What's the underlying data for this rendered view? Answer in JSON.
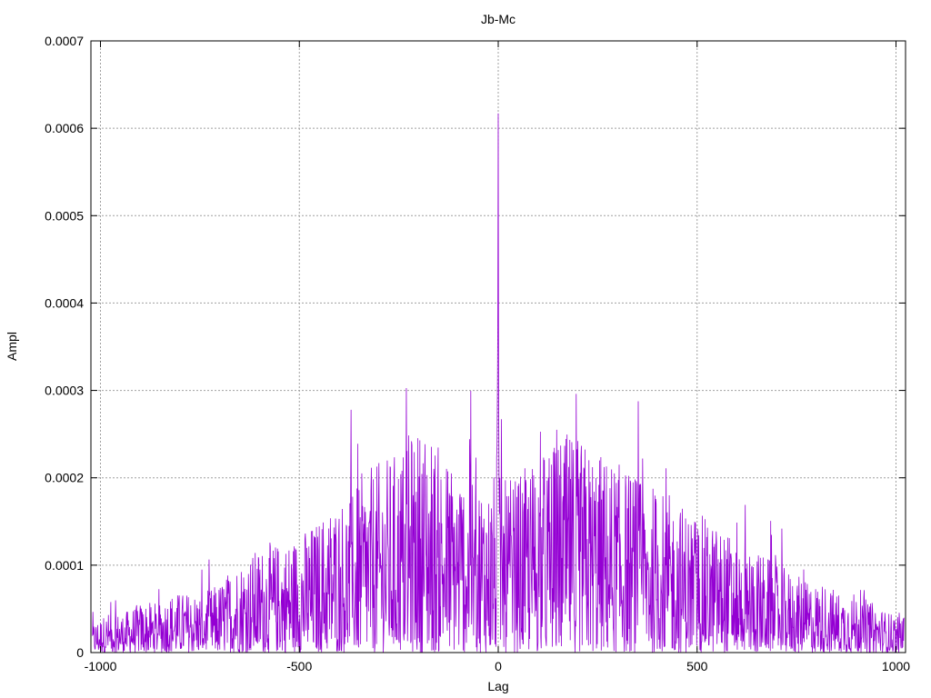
{
  "chart_data": {
    "type": "line",
    "title": "Jb-Mc",
    "xlabel": "Lag",
    "ylabel": "Ampl",
    "xlim": [
      -1024,
      1024
    ],
    "ylim": [
      0,
      0.0007
    ],
    "xticks": [
      -1000,
      -500,
      0,
      500,
      1000
    ],
    "xtick_labels": [
      "-1000",
      "-500",
      "0",
      "500",
      "1000"
    ],
    "yticks": [
      0,
      0.0001,
      0.0002,
      0.0003,
      0.0004,
      0.0005,
      0.0006,
      0.0007
    ],
    "ytick_labels": [
      "0",
      "0.0001",
      "0.0002",
      "0.0003",
      "0.0004",
      "0.0005",
      "0.0006",
      "0.0007"
    ],
    "grid": true,
    "legend": "none",
    "series": [
      {
        "color": "#9400d3",
        "x": [
          -1020,
          -980,
          -940,
          -900,
          -860,
          -820,
          -780,
          -740,
          -700,
          -660,
          -620,
          -580,
          -540,
          -500,
          -460,
          -420,
          -380,
          -340,
          -300,
          -260,
          -220,
          -180,
          -140,
          -100,
          -60,
          -20,
          -10,
          -5,
          -2,
          -1,
          0,
          1,
          2,
          5,
          10,
          20,
          60,
          100,
          140,
          180,
          220,
          260,
          300,
          340,
          380,
          420,
          460,
          500,
          540,
          580,
          620,
          660,
          700,
          740,
          780,
          820,
          860,
          900,
          940,
          980,
          1020
        ],
        "y": [
          3e-05,
          4e-05,
          4e-05,
          5e-05,
          5e-05,
          6e-05,
          6e-05,
          6e-05,
          7e-05,
          9e-05,
          0.0001,
          0.00011,
          0.00011,
          0.00012,
          0.00013,
          0.00015,
          0.00016,
          0.00018,
          0.00019,
          0.0002,
          0.00022,
          0.00023,
          0.0002,
          0.00019,
          0.00018,
          0.00017,
          0.00018,
          0.00016,
          0.0003,
          0.00039,
          0.000617,
          0.0003,
          0.0002,
          0.00017,
          0.00018,
          0.00017,
          0.00018,
          0.0002,
          0.00021,
          0.00022,
          0.00021,
          0.0002,
          0.00019,
          0.00018,
          0.00017,
          0.00016,
          0.00015,
          0.00014,
          0.00013,
          0.00012,
          0.00011,
          0.0001,
          9e-05,
          8e-05,
          7e-05,
          7e-05,
          6e-05,
          6e-05,
          5e-05,
          4e-05,
          4e-05
        ]
      }
    ]
  }
}
